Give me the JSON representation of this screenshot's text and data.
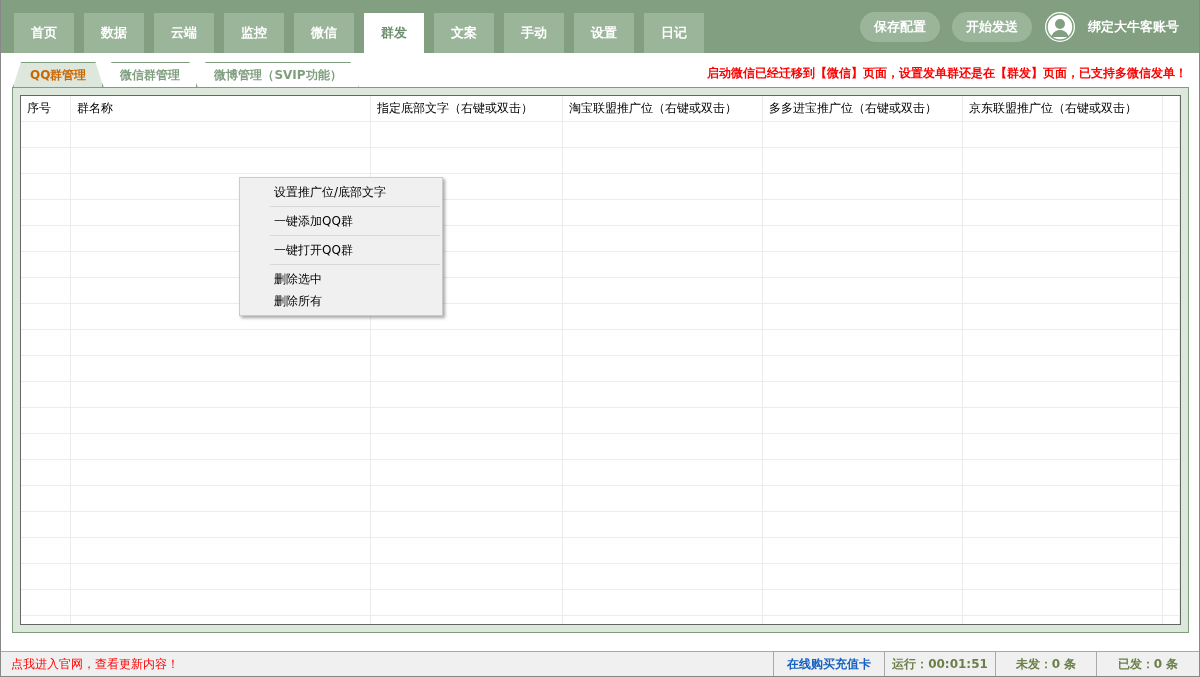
{
  "nav_tabs": [
    {
      "label": "首页",
      "selected": false
    },
    {
      "label": "数据",
      "selected": false
    },
    {
      "label": "云端",
      "selected": false
    },
    {
      "label": "监控",
      "selected": false
    },
    {
      "label": "微信",
      "selected": false
    },
    {
      "label": "群发",
      "selected": true
    },
    {
      "label": "文案",
      "selected": false
    },
    {
      "label": "手动",
      "selected": false
    },
    {
      "label": "设置",
      "selected": false
    },
    {
      "label": "日记",
      "selected": false
    }
  ],
  "header_buttons": [
    "保存配置",
    "开始发送"
  ],
  "account": {
    "label": "绑定大牛客账号"
  },
  "sub_tabs": [
    {
      "label": "QQ群管理",
      "selected": true
    },
    {
      "label": "微信群管理",
      "selected": false
    },
    {
      "label": "微博管理（SVIP功能）",
      "selected": false
    }
  ],
  "notice": "启动微信已经迁移到【微信】页面，设置发单群还是在【群发】页面，已支持多微信发单！",
  "table": {
    "columns": [
      "序号",
      "群名称",
      "指定底部文字（右键或双击）",
      "淘宝联盟推广位（右键或双击）",
      "多多进宝推广位（右键或双击）",
      "京东联盟推广位（右键或双击）"
    ]
  },
  "context_menu": [
    {
      "kind": "item",
      "label": "设置推广位/底部文字"
    },
    {
      "kind": "separator"
    },
    {
      "kind": "item",
      "label": "一键添加QQ群"
    },
    {
      "kind": "separator"
    },
    {
      "kind": "item",
      "label": "一键打开QQ群"
    },
    {
      "kind": "separator"
    },
    {
      "kind": "item",
      "label": "删除选中"
    },
    {
      "kind": "item",
      "label": "删除所有"
    }
  ],
  "status_bar": {
    "website_link": "点我进入官网，查看更新内容！",
    "buy_link": "在线购买充值卡",
    "runtime": "运行：00:01:51",
    "unsent": "未发：0 条",
    "sent": "已发：0 条"
  }
}
